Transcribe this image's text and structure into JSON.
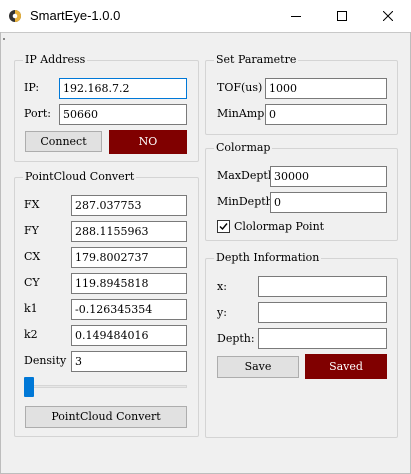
{
  "window": {
    "title": "SmartEye-1.0.0",
    "icon": "app-logo-icon",
    "controls": [
      "minimize-icon",
      "maximize-icon",
      "close-icon"
    ]
  },
  "ip_address": {
    "group_title": "IP Address",
    "ip_label": "IP:",
    "ip_value": "192.168.7.2",
    "port_label": "Port:",
    "port_value": "50660",
    "connect_button": "Connect",
    "status_button": "NO",
    "status_color": "#800000"
  },
  "pointcloud": {
    "group_title": "PointCloud Convert",
    "params": [
      {
        "label": "FX",
        "value": "287.037753"
      },
      {
        "label": "FY",
        "value": "288.1155963"
      },
      {
        "label": "CX",
        "value": "179.8002737"
      },
      {
        "label": "CY",
        "value": "119.8945818"
      },
      {
        "label": "k1",
        "value": "-0.126345354"
      },
      {
        "label": "k2",
        "value": "0.149484016"
      }
    ],
    "density_label": "Density",
    "density_value": "3",
    "slider_position": 0.0,
    "convert_button": "PointCloud Convert"
  },
  "set_parameter": {
    "group_title": "Set Parametre",
    "tof_label": "TOF(us)",
    "tof_value": "1000",
    "minamp_label": "MinAmp",
    "minamp_value": "0"
  },
  "colormap": {
    "group_title": "Colormap",
    "maxdepth_label": "MaxDepth",
    "maxdepth_value": "30000",
    "mindepth_label": "MinDepth",
    "mindepth_value": "0",
    "checkbox_label": "Clolormap Point",
    "checkbox_checked": true
  },
  "depth_info": {
    "group_title": "Depth Information",
    "x_label": "x:",
    "x_value": "",
    "y_label": "y:",
    "y_value": "",
    "depth_label": "Depth:",
    "depth_value": "",
    "save_button": "Save",
    "saved_button": "Saved"
  },
  "colors": {
    "accent": "#0078d7",
    "dark_button": "#800000",
    "background": "#f0f0f0"
  }
}
